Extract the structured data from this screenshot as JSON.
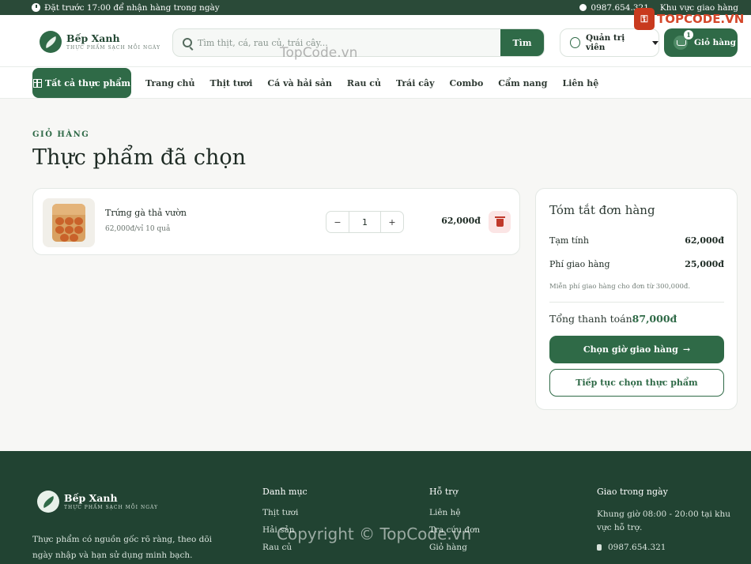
{
  "topbar": {
    "notice": "Đặt trước 17:00 để nhận hàng trong ngày",
    "phone": "0987.654.321",
    "region": "Khu vực giao hàng"
  },
  "header": {
    "brand": "Bếp Xanh",
    "tagline": "THỰC PHẨM SẠCH MỖI NGÀY",
    "search_placeholder": "Tìm thịt, cá, rau củ, trái cây...",
    "search_button": "Tìm",
    "account_label": "Quản trị viên",
    "cart_label": "Giỏ hàng",
    "cart_count": "1"
  },
  "nav": {
    "all_label": "Tất cả thực phẩm",
    "links": [
      "Trang chủ",
      "Thịt tươi",
      "Cá và hải sản",
      "Rau củ",
      "Trái cây",
      "Combo",
      "Cẩm nang",
      "Liên hệ"
    ]
  },
  "page": {
    "eyebrow": "GIỎ HÀNG",
    "title": "Thực phẩm đã chọn"
  },
  "cart_items": [
    {
      "name": "Trứng gà thả vườn",
      "unit_price": "62,000đ/vỉ 10 quả",
      "quantity": "1",
      "line_total": "62,000đ"
    }
  ],
  "controls": {
    "decrement": "−",
    "increment": "+"
  },
  "summary": {
    "heading": "Tóm tắt đơn hàng",
    "subtotal_label": "Tạm tính",
    "subtotal_value": "62,000đ",
    "shipping_label": "Phí giao hàng",
    "shipping_value": "25,000đ",
    "free_ship_note": "Miễn phí giao hàng cho đơn từ 300,000đ.",
    "total_label": "Tổng thanh toán",
    "total_value": "87,000đ",
    "primary_button": "Chọn giờ giao hàng",
    "secondary_button": "Tiếp tục chọn thực phẩm"
  },
  "footer": {
    "brand": "Bếp Xanh",
    "tagline": "THỰC PHẨM SẠCH MỖI NGÀY",
    "description": "Thực phẩm có nguồn gốc rõ ràng, theo dõi ngày nhập và hạn sử dụng minh bạch.",
    "col1_title": "Danh mục",
    "col1_links": [
      "Thịt tươi",
      "Hải sản",
      "Rau củ"
    ],
    "col2_title": "Hỗ trợ",
    "col2_links": [
      "Liên hệ",
      "Tra cứu đơn",
      "Giỏ hàng"
    ],
    "col3_title": "Giao trong ngày",
    "col3_text": "Khung giờ 08:00 - 20:00 tại khu vực hỗ trợ.",
    "col3_phone": "0987.654.321"
  },
  "watermarks": {
    "top": "TopCode.vn",
    "bottom": "Copyright © TopCode.vn",
    "logo_text": "TOPCODE.VN"
  },
  "colors": {
    "brand_green": "#2f6a47",
    "footer_bg": "#214332",
    "danger": "#c0392b"
  }
}
